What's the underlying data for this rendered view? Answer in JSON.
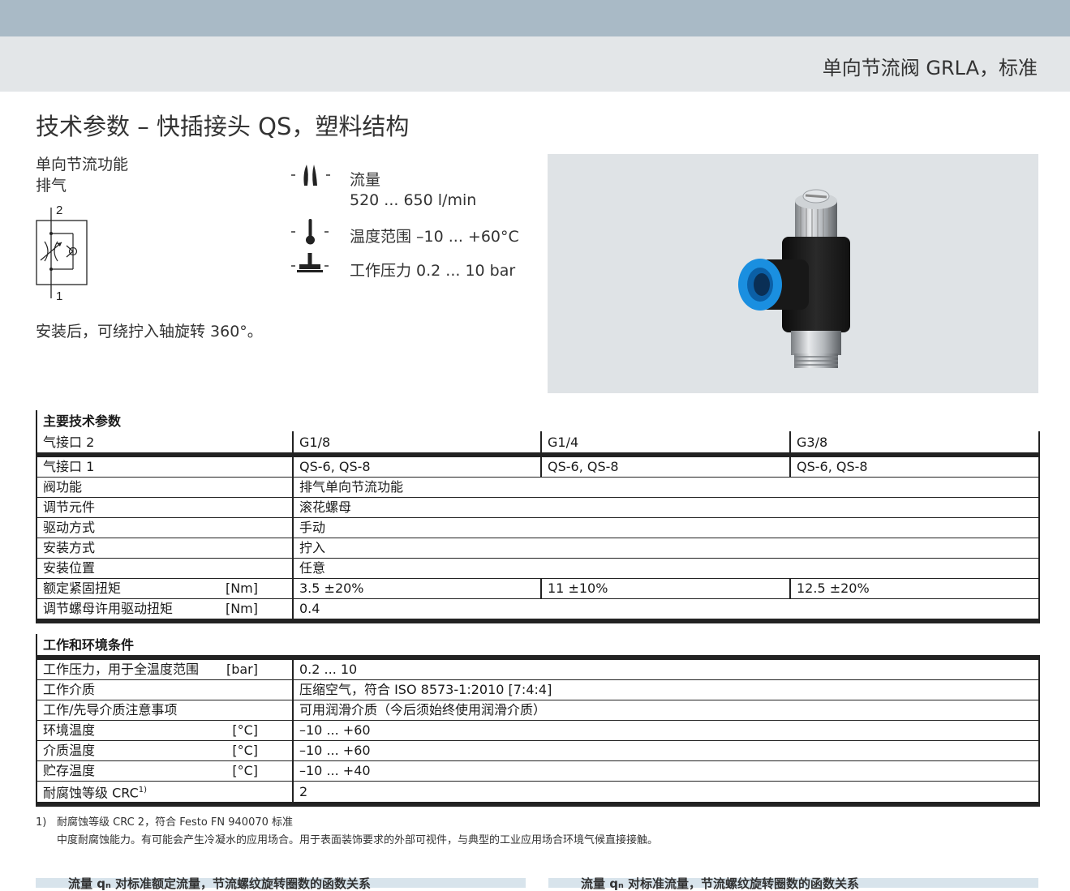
{
  "header": {
    "title": "单向节流阀 GRLA，标准"
  },
  "section_title": "技术参数 – 快插接头 QS，塑料结构",
  "function": {
    "line1": "单向节流功能",
    "line2": "排气",
    "port_top": "2",
    "port_bottom": "1",
    "rotate_note": "安装后，可绕拧入轴旋转 360°。"
  },
  "properties": [
    {
      "icon": "flow-icon",
      "label": "流量",
      "value": "520 ... 650 l/min"
    },
    {
      "icon": "thermometer-icon",
      "label": "温度范围 –10 ... +60°C"
    },
    {
      "icon": "pressure-icon",
      "label": "工作压力 0.2 ... 10 bar"
    }
  ],
  "product_image": {
    "icon": "throttle-valve-product-image"
  },
  "main_specs": {
    "caption": "主要技术参数",
    "header": {
      "label": "气接口 2",
      "cols": [
        "G1/8",
        "G1/4",
        "G3/8"
      ]
    },
    "rows": [
      {
        "label": "气接口 1",
        "unit": "",
        "values": [
          "QS-6, QS-8",
          "QS-6, QS-8",
          "QS-6, QS-8"
        ]
      },
      {
        "label": "阀功能",
        "unit": "",
        "value": "排气单向节流功能"
      },
      {
        "label": "调节元件",
        "unit": "",
        "value": "滚花螺母"
      },
      {
        "label": "驱动方式",
        "unit": "",
        "value": "手动"
      },
      {
        "label": "安装方式",
        "unit": "",
        "value": "拧入"
      },
      {
        "label": "安装位置",
        "unit": "",
        "value": "任意"
      },
      {
        "label": "额定紧固扭矩",
        "unit": "[Nm]",
        "values": [
          "3.5 ±20%",
          "11 ±10%",
          "12.5 ±20%"
        ]
      },
      {
        "label": "调节螺母许用驱动扭矩",
        "unit": "[Nm]",
        "value": "0.4"
      }
    ]
  },
  "conditions": {
    "caption": "工作和环境条件",
    "rows": [
      {
        "label": "工作压力，用于全温度范围",
        "unit": "[bar]",
        "value": "0.2 ... 10"
      },
      {
        "label": "工作介质",
        "unit": "",
        "value": "压缩空气，符合 ISO 8573-1:2010 [7:4:4]"
      },
      {
        "label": "工作/先导介质注意事项",
        "unit": "",
        "value": "可用润滑介质（今后须始终使用润滑介质）"
      },
      {
        "label": "环境温度",
        "unit": "[°C]",
        "value": "–10 ... +60"
      },
      {
        "label": "介质温度",
        "unit": "[°C]",
        "value": "–10 ... +60"
      },
      {
        "label": "贮存温度",
        "unit": "[°C]",
        "value": "–10 ... +40"
      },
      {
        "label": "耐腐蚀等级 CRC",
        "sup": "1)",
        "unit": "",
        "value": "2"
      }
    ]
  },
  "footnote": {
    "num": "1)",
    "line1": "耐腐蚀等级 CRC 2，符合 Festo FN 940070 标准",
    "line2": "中度耐腐蚀能力。有可能会产生冷凝水的应用场合。用于表面装饰要求的外部可视件，与典型的工业应用场合环境气候直接接触。"
  },
  "bottom": {
    "left": "流量 qₙ 对标准额定流量，节流螺纹旋转圈数的函数关系",
    "right": "流量 qₙ 对标准流量，节流螺纹旋转圈数的函数关系"
  },
  "colors": {
    "top_bar": "#a9bac6",
    "header_band": "#e3e6e8",
    "photo_bg": "#dfe3e6",
    "fitting_blue": "#1a8fe0"
  }
}
